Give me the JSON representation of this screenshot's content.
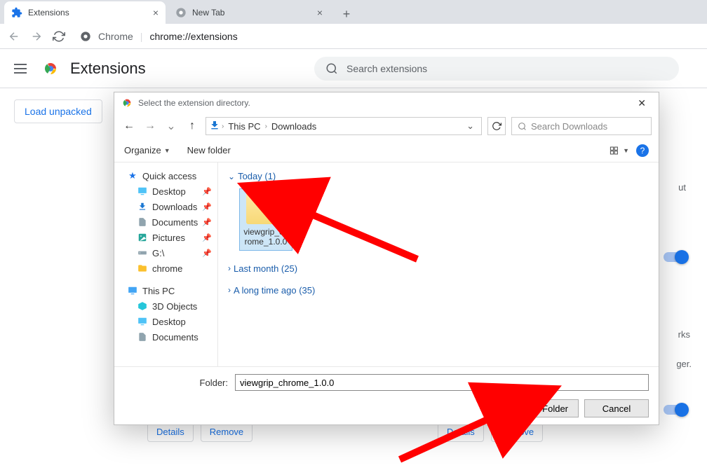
{
  "tabs": [
    {
      "title": "Extensions",
      "favicon": "puzzle"
    },
    {
      "title": "New Tab",
      "favicon": "chrome-gray"
    }
  ],
  "omnibox": {
    "scheme": "Chrome",
    "url": "chrome://extensions"
  },
  "page": {
    "title": "Extensions",
    "search_placeholder": "Search extensions",
    "load_unpacked": "Load unpacked"
  },
  "cards": {
    "details": "Details",
    "remove": "Remove",
    "snippet1": "ut",
    "snippet2": "rks",
    "snippet3": "ger."
  },
  "dialog": {
    "title": "Select the extension directory.",
    "breadcrumb": [
      "This PC",
      "Downloads"
    ],
    "search_placeholder": "Search Downloads",
    "organize": "Organize",
    "newfolder": "New folder",
    "tree": {
      "quick_access": "Quick access",
      "desktop": "Desktop",
      "downloads": "Downloads",
      "documents": "Documents",
      "pictures": "Pictures",
      "g_drive": "G:\\",
      "chrome": "chrome",
      "this_pc": "This PC",
      "objects3d": "3D Objects",
      "desktop2": "Desktop",
      "documents2": "Documents"
    },
    "groups": {
      "today": "Today (1)",
      "last_month": "Last month (25)",
      "long_ago": "A long time ago (35)"
    },
    "folder_item": "viewgrip_chrome_1.0.0",
    "folder_label": "Folder:",
    "folder_value": "viewgrip_chrome_1.0.0",
    "select_btn": "Select Folder",
    "cancel_btn": "Cancel"
  }
}
